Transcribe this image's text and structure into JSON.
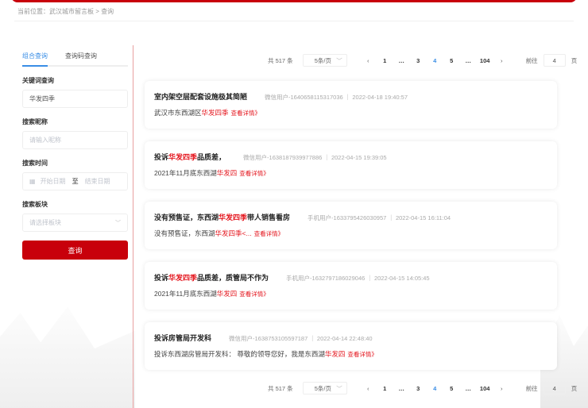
{
  "breadcrumb": "当前位置：武汉城市留言板 > 查询",
  "search": {
    "tabs": [
      {
        "label": "组合查询",
        "active": true
      },
      {
        "label": "查询码查询",
        "active": false
      }
    ],
    "keyword_label": "关键词查询",
    "keyword_value": "华发四季",
    "nickname_label": "搜索昵称",
    "nickname_placeholder": "请输入昵称",
    "time_label": "搜索时间",
    "start_placeholder": "开始日期",
    "to": "至",
    "end_placeholder": "结束日期",
    "board_label": "搜索板块",
    "board_placeholder": "请选择板块",
    "submit": "查询"
  },
  "pagination": {
    "total": "共 517 条",
    "page_size": "5条/页",
    "prev": "‹",
    "next": "›",
    "pages": [
      "1",
      "…",
      "3",
      "4",
      "5",
      "…",
      "104"
    ],
    "current": "4",
    "goto_label": "前往",
    "goto_value": "4",
    "goto_suffix": "页"
  },
  "results": [
    {
      "title": [
        {
          "t": "室内架空层配套设施极其简陋"
        }
      ],
      "meta": "微信用户-1640658115317036 ｜ 2022-04-18 19:40:57",
      "summary": [
        {
          "t": "武汉市东西湖区"
        },
        {
          "t": "华发四季",
          "hl": true
        }
      ],
      "more": "查看详情》"
    },
    {
      "title": [
        {
          "t": "投诉"
        },
        {
          "t": "华发四季",
          "hl": true
        },
        {
          "t": "品质差，"
        }
      ],
      "meta": "微信用户-1638187939977886 ｜ 2022-04-15 19:39:05",
      "summary": [
        {
          "t": "2021年11月底东西湖"
        },
        {
          "t": "华发四",
          "hl": true
        }
      ],
      "more": "查看详情》"
    },
    {
      "title": [
        {
          "t": "没有预售证，东西湖"
        },
        {
          "t": "华发四季",
          "hl": true
        },
        {
          "t": "带人销售看房"
        }
      ],
      "meta": "手机用户-1633795426030957 ｜ 2022-04-15 16:11:04",
      "summary": [
        {
          "t": "没有预售证，东西湖"
        },
        {
          "t": "华发四季<...",
          "hl": true
        }
      ],
      "more": "查看详情》"
    },
    {
      "title": [
        {
          "t": "投诉"
        },
        {
          "t": "华发四季",
          "hl": true
        },
        {
          "t": "品质差，质管局不作为"
        }
      ],
      "meta": "手机用户-1632797186029046 ｜ 2022-04-15 14:05:45",
      "summary": [
        {
          "t": "2021年11月底东西湖"
        },
        {
          "t": "华发四",
          "hl": true
        }
      ],
      "more": "查看详情》"
    },
    {
      "title": [
        {
          "t": "投诉房管局开发科"
        }
      ],
      "meta": "微信用户-1638753105597187 ｜ 2022-04-14 22:48:40",
      "summary": [
        {
          "t": "投诉东西湖房管局开发科：  尊敬的领导您好，我是东西湖"
        },
        {
          "t": "华发四",
          "hl": true
        }
      ],
      "more": "查看详情》"
    }
  ],
  "colors": {
    "brand": "#c8000b",
    "accent": "#3a8ee6",
    "highlight": "#e4141c"
  }
}
